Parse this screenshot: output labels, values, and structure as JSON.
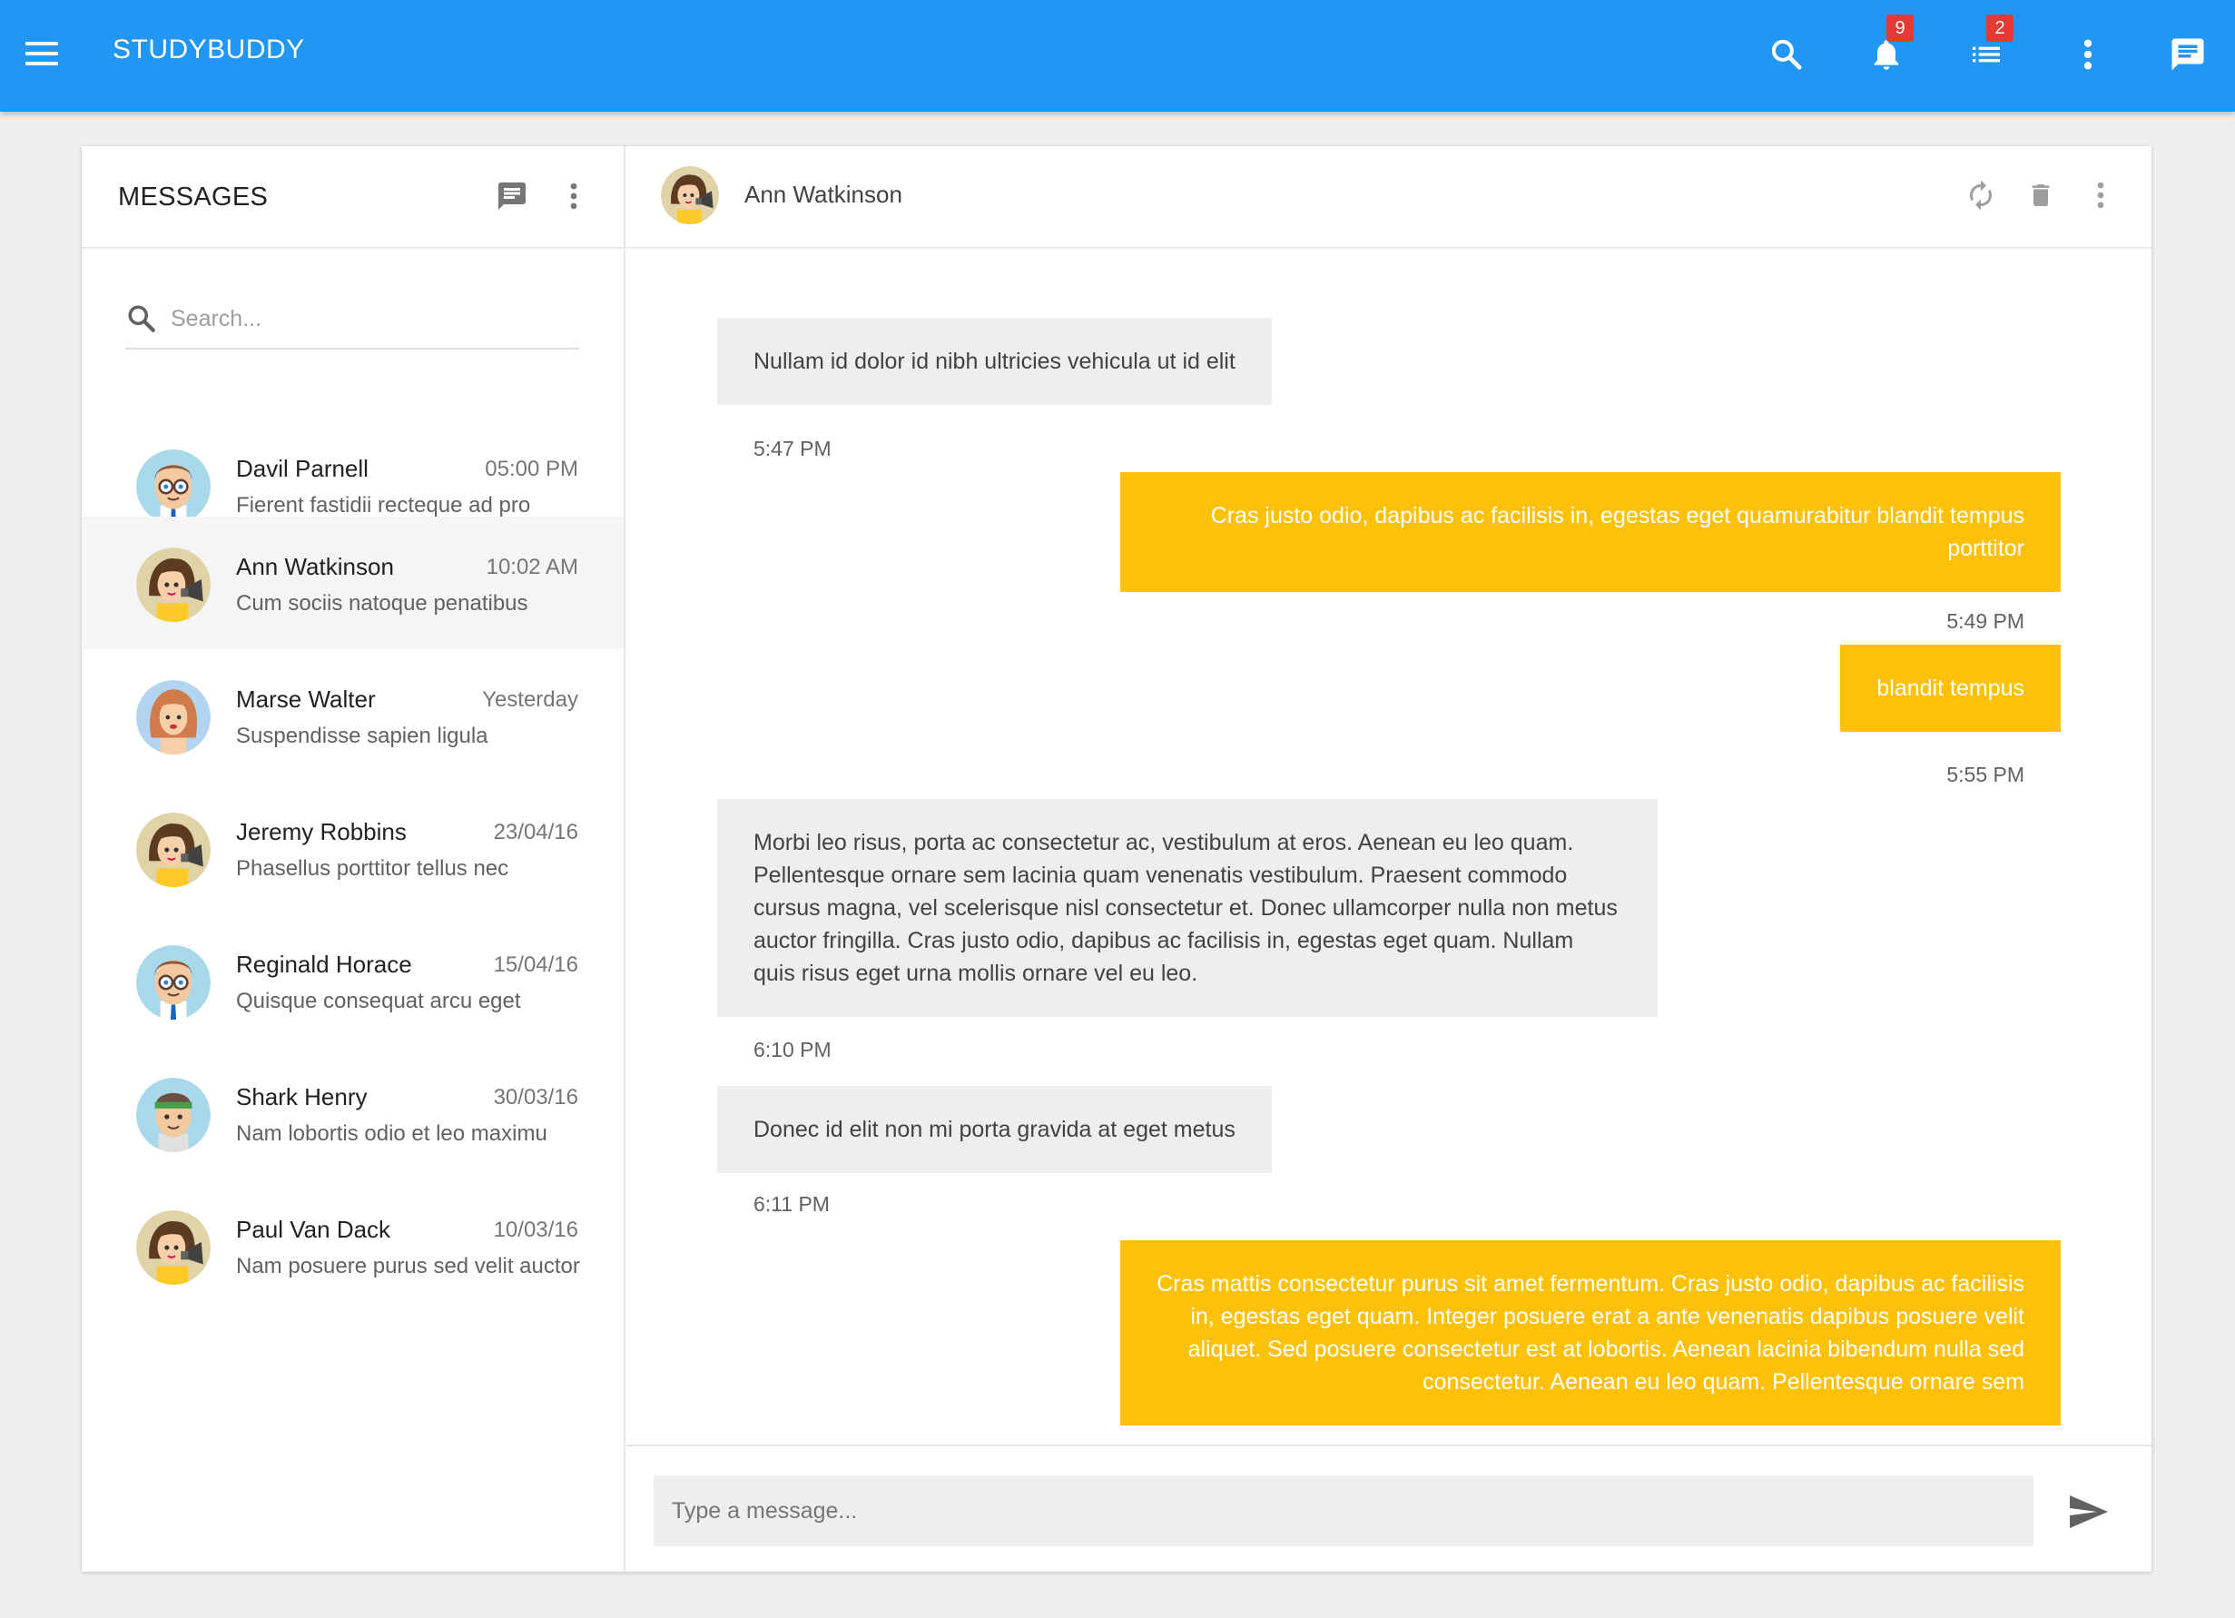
{
  "appbar": {
    "title": "STUDYBUDDY",
    "notifications_count": "9",
    "tasks_count": "2",
    "color": "#2196f3"
  },
  "sidebar": {
    "title": "MESSAGES",
    "search_placeholder": "Search...",
    "conversations": [
      {
        "name": "Davil Parnell",
        "time": "05:00 PM",
        "preview": "Fierent fastidii recteque ad pro",
        "avatar": "boy-glasses-avatar"
      },
      {
        "name": "Ann Watkinson",
        "time": "10:02 AM",
        "preview": "Cum sociis natoque penatibus",
        "avatar": "woman-megaphone-avatar",
        "active": true
      },
      {
        "name": "Marse Walter",
        "time": "Yesterday",
        "preview": "Suspendisse sapien ligula",
        "avatar": "woman-avatar"
      },
      {
        "name": "Jeremy Robbins",
        "time": "23/04/16",
        "preview": "Phasellus porttitor tellus nec",
        "avatar": "woman-megaphone-avatar"
      },
      {
        "name": "Reginald Horace",
        "time": "15/04/16",
        "preview": "Quisque consequat arcu eget",
        "avatar": "boy-glasses-avatar"
      },
      {
        "name": "Shark Henry",
        "time": "30/03/16",
        "preview": "Nam lobortis odio et leo maximu",
        "avatar": "boy-headband-avatar"
      },
      {
        "name": "Paul Van Dack",
        "time": "10/03/16",
        "preview": "Nam posuere purus sed velit auctor",
        "avatar": "woman-megaphone-avatar"
      }
    ]
  },
  "chat": {
    "contact_name": "Ann Watkinson",
    "messages": [
      {
        "dir": "in",
        "text": "Nullam id dolor id nibh ultricies vehicula ut id elit",
        "time": "5:47 PM"
      },
      {
        "dir": "out",
        "text": "Cras justo odio, dapibus ac facilisis in, egestas eget quamurabitur blandit tempus porttitor",
        "time": "5:49 PM"
      },
      {
        "dir": "out",
        "text": "blandit tempus",
        "time": "5:55 PM"
      },
      {
        "dir": "in",
        "text": "Morbi leo risus, porta ac consectetur ac, vestibulum at eros. Aenean eu leo quam. Pellentesque ornare sem lacinia quam venenatis vestibulum. Praesent commodo cursus magna, vel scelerisque nisl consectetur et. Donec ullamcorper nulla non metus auctor fringilla. Cras justo odio, dapibus ac facilisis in, egestas eget quam. Nullam quis risus eget urna mollis ornare vel eu leo.",
        "time": "6:10 PM"
      },
      {
        "dir": "in",
        "text": "Donec id elit non mi porta gravida at eget metus",
        "time": "6:11 PM"
      },
      {
        "dir": "out",
        "text": "Cras mattis consectetur purus sit amet fermentum. Cras justo odio, dapibus ac facilisis in, egestas eget quam. Integer posuere erat a ante venenatis dapibus posuere velit aliquet. Sed posuere consectetur est at lobortis. Aenean lacinia bibendum nulla sed consectetur. Aenean eu leo quam. Pellentesque ornare sem",
        "time": ""
      }
    ],
    "composer_placeholder": "Type a message...",
    "incoming_color": "#eeeeee",
    "outgoing_color": "#ffc107"
  }
}
